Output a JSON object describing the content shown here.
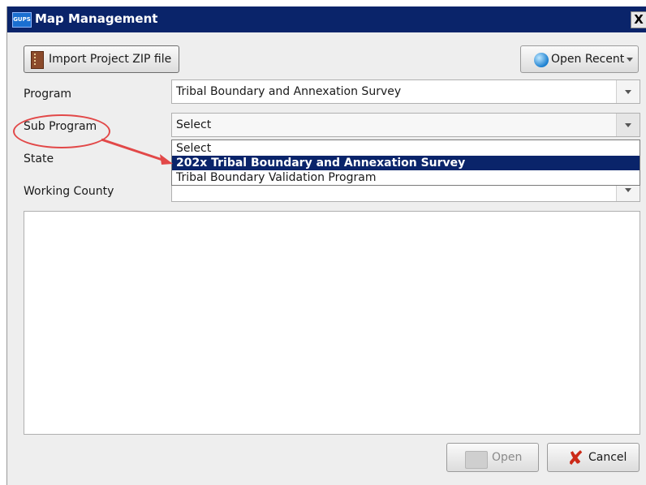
{
  "window": {
    "title": "Map Management",
    "app_icon_text": "GUPS",
    "close_label": "X"
  },
  "toolbar": {
    "import_label": "Import Project ZIP file",
    "recent_label": "Open Recent"
  },
  "form": {
    "program": {
      "label": "Program",
      "value": "Tribal Boundary and Annexation Survey"
    },
    "sub_program": {
      "label": "Sub Program",
      "value": "Select",
      "options": [
        "Select",
        "202x Tribal Boundary and Annexation Survey",
        "Tribal Boundary Validation Program"
      ],
      "highlighted_option": "202x Tribal Boundary and Annexation Survey"
    },
    "state": {
      "label": "State",
      "value": ""
    },
    "working_county": {
      "label": "Working County",
      "value": ""
    }
  },
  "footer": {
    "open_label": "Open",
    "cancel_label": "Cancel"
  },
  "colors": {
    "titlebar": "#0a246a",
    "highlight": "#0a246a",
    "annotation": "#e24848"
  }
}
